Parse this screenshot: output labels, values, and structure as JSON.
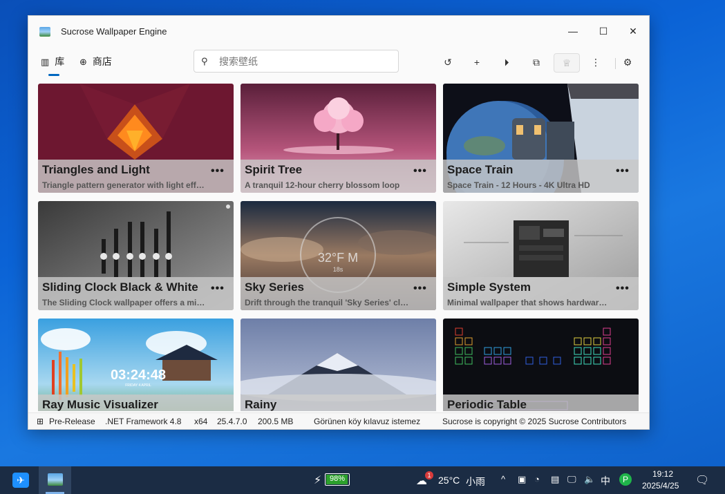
{
  "window": {
    "title": "Sucrose Wallpaper Engine",
    "minimize": "—",
    "maximize": "☐",
    "close": "✕"
  },
  "tabs": [
    {
      "icon": "library-icon",
      "glyph": "▥",
      "label": "库"
    },
    {
      "icon": "store-icon",
      "glyph": "⊕",
      "label": "商店"
    }
  ],
  "search": {
    "placeholder": "搜索壁纸",
    "value": ""
  },
  "toolbar": {
    "history": "↺",
    "add": "+",
    "play": "⏵",
    "display": "⧉",
    "trophy": "♕",
    "more": "⋮",
    "settings": "⚙"
  },
  "cards": [
    {
      "title": "Triangles and Light",
      "desc": "Triangle pattern generator with light effects",
      "more": "•••"
    },
    {
      "title": "Spirit Tree",
      "desc": "A tranquil 12-hour cherry blossom loop",
      "more": "•••"
    },
    {
      "title": "Space Train",
      "desc": "Space Train - 12 Hours - 4K Ultra HD",
      "more": "•••"
    },
    {
      "title": "Sliding Clock Black & White",
      "desc": "The Sliding Clock wallpaper offers a minimal look",
      "more": "•••"
    },
    {
      "title": "Sky Series",
      "desc": "Drift through the tranquil 'Sky Series' clouds",
      "more": "•••"
    },
    {
      "title": "Simple System",
      "desc": "Minimal wallpaper that shows hardware info",
      "more": "•••"
    },
    {
      "title": "Ray Music Visualizer",
      "desc": "",
      "more": ""
    },
    {
      "title": "Rainy",
      "desc": "",
      "more": ""
    },
    {
      "title": "Periodic Table",
      "desc": "",
      "more": ""
    }
  ],
  "thumbs": {
    "sky_clock": "32°F  M",
    "sky_sub": "18s",
    "ray_clock": "03:24:48",
    "ray_date": "FRIDAY 4 APRIL"
  },
  "status": {
    "channel": "Pre-Release",
    "framework": ".NET Framework 4.8",
    "arch": "x64",
    "version": "25.4.7.0",
    "memory": "200.5 MB",
    "guide": "Görünen köy kılavuz istemez",
    "copyright": "Sucrose is copyright © 2025 Sucrose Contributors"
  },
  "taskbar": {
    "battery_pct": "98%",
    "battery_level": 0.98,
    "temp": "25°C",
    "weather": "小雨",
    "weather_badge": "1",
    "ime": "中",
    "time": "19:12",
    "date": "2025/4/25"
  }
}
